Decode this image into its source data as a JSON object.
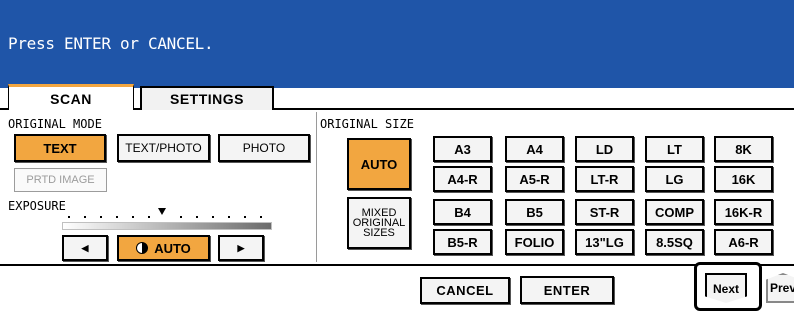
{
  "message": "Press ENTER or CANCEL.",
  "tabs": {
    "scan": "SCAN",
    "settings": "SETTINGS"
  },
  "original_mode": {
    "label": "ORIGINAL MODE",
    "text": "TEXT",
    "text_photo": "TEXT/PHOTO",
    "photo": "PHOTO",
    "printed_image": "PRTD IMAGE",
    "selected": "TEXT"
  },
  "exposure": {
    "label": "EXPOSURE",
    "left_arrow": "◀",
    "auto": "AUTO",
    "right_arrow": "▶",
    "mode": "AUTO"
  },
  "original_size": {
    "label": "ORIGINAL SIZE",
    "auto": "AUTO",
    "mixed_line1": "MIXED",
    "mixed_line2": "ORIGINAL",
    "mixed_line3": "SIZES",
    "selected": "AUTO",
    "sizes": [
      [
        "A3",
        "A4",
        "LD",
        "LT",
        "8K"
      ],
      [
        "A4-R",
        "A5-R",
        "LT-R",
        "LG",
        "16K"
      ],
      [
        "B4",
        "B5",
        "ST-R",
        "COMP",
        "16K-R"
      ],
      [
        "B5-R",
        "FOLIO",
        "13\"LG",
        "8.5SQ",
        "A6-R"
      ]
    ]
  },
  "actions": {
    "cancel": "CANCEL",
    "enter": "ENTER",
    "next": "Next",
    "prev": "Prev"
  },
  "colors": {
    "message_bar": "#1f55a8",
    "selected_accent": "#f2a640"
  }
}
